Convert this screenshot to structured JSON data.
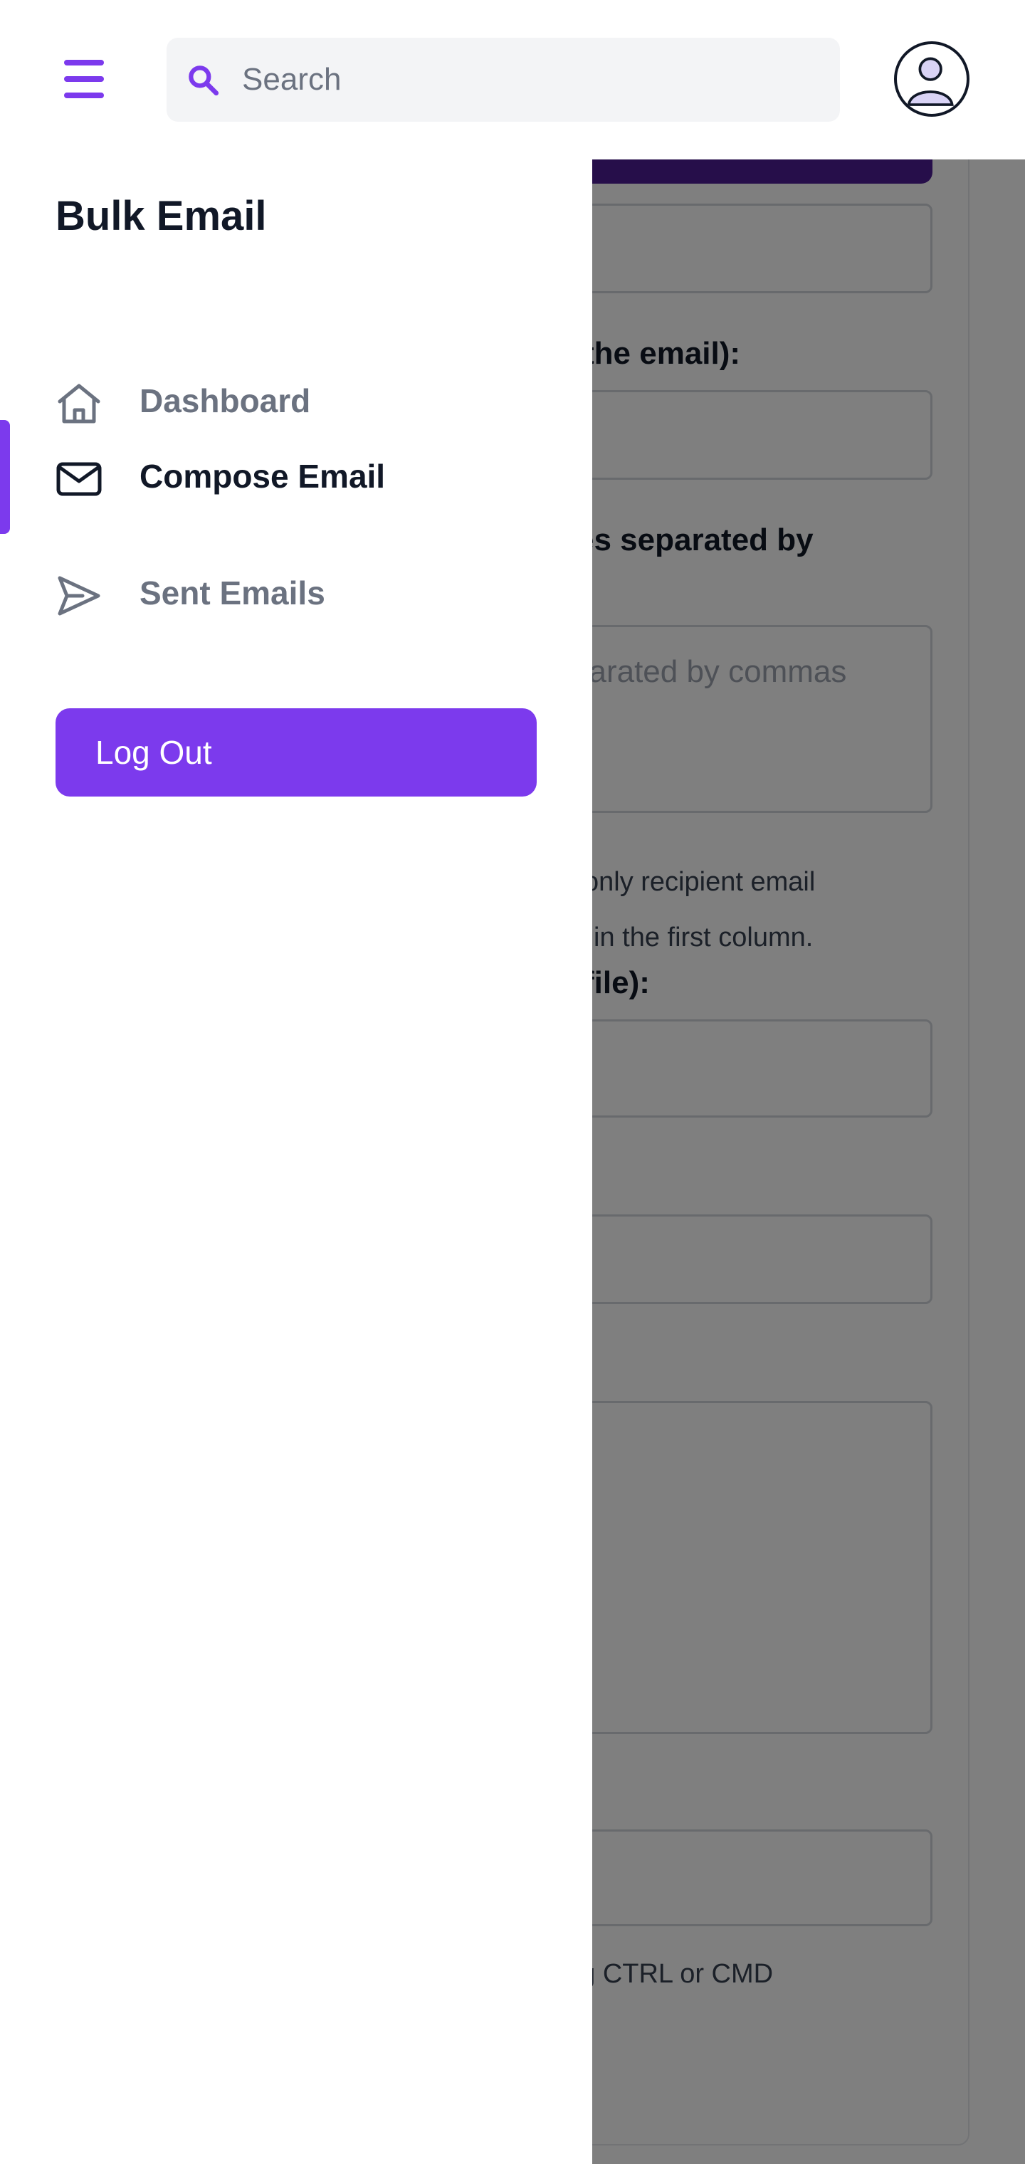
{
  "header": {
    "search_placeholder": "Search"
  },
  "sidebar": {
    "title": "Bulk Email",
    "items": [
      {
        "label": "Dashboard",
        "icon": "home-icon",
        "active": false
      },
      {
        "label": "Compose Email",
        "icon": "mail-icon",
        "active": true
      },
      {
        "label": "Sent Emails",
        "icon": "send-icon",
        "active": false
      }
    ],
    "logout_label": "Log Out"
  },
  "background_form": {
    "label_email": "the email):",
    "label_recipients": "es separated by",
    "recipients_placeholder": "parated by commas",
    "help_csv_line1": "only recipient email",
    "help_csv_line2": "in the first column.",
    "label_file": "file):",
    "help_attachments": "ng CTRL or CMD"
  },
  "colors": {
    "accent": "#7c3aed",
    "overlay": "rgba(0,0,0,0.5)"
  }
}
